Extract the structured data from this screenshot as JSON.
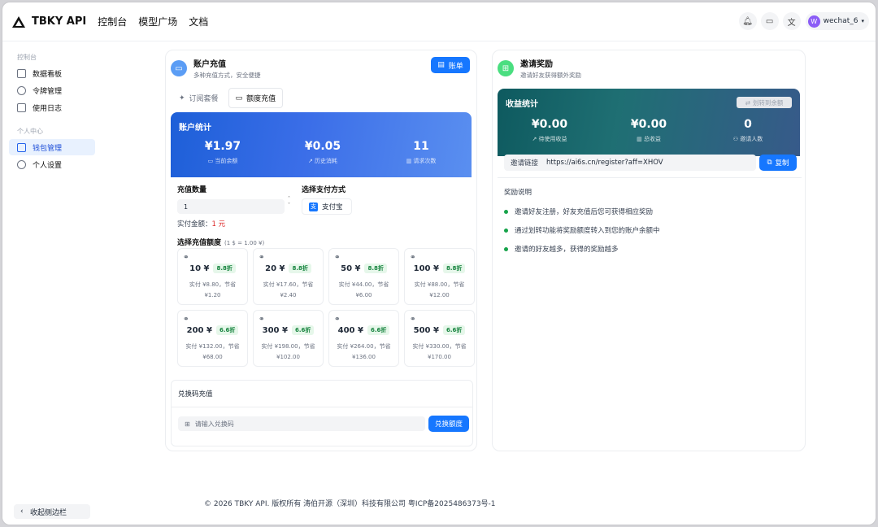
{
  "header": {
    "brand": "TBKY API",
    "nav": [
      "控制台",
      "模型广场",
      "文档"
    ],
    "user": "wechat_6",
    "avatar_letter": "W"
  },
  "sidebar": {
    "group1": "控制台",
    "items1": [
      "数据看板",
      "令牌管理",
      "使用日志"
    ],
    "group2": "个人中心",
    "items2": [
      "钱包管理",
      "个人设置"
    ],
    "collapse": "收起侧边栏"
  },
  "recharge": {
    "title": "账户充值",
    "subtitle": "多种充值方式，安全便捷",
    "bill_button": "账单",
    "tabs": [
      "订阅套餐",
      "额度充值"
    ],
    "stats_title": "账户统计",
    "stats": [
      {
        "value": "¥1.97",
        "label": "当前余额"
      },
      {
        "value": "¥0.05",
        "label": "历史消耗"
      },
      {
        "value": "11",
        "label": "请求次数"
      }
    ],
    "amount_label": "充值数量",
    "amount_value": "1",
    "pay_label": "选择支付方式",
    "pay_method": "支付宝",
    "pay_icon_char": "支",
    "actual_label": "实付金额：",
    "actual_value": "1 元",
    "select_label": "选择充值额度",
    "rate": "(1 $ = 1.00 ¥)",
    "packages": [
      {
        "amount": "10 ¥",
        "discount": "8.8折",
        "line1": "实付 ¥8.80，节省",
        "line2": "¥1.20"
      },
      {
        "amount": "20 ¥",
        "discount": "8.8折",
        "line1": "实付 ¥17.60，节省",
        "line2": "¥2.40"
      },
      {
        "amount": "50 ¥",
        "discount": "8.8折",
        "line1": "实付 ¥44.00，节省",
        "line2": "¥6.00"
      },
      {
        "amount": "100 ¥",
        "discount": "8.8折",
        "line1": "实付 ¥88.00，节省",
        "line2": "¥12.00"
      },
      {
        "amount": "200 ¥",
        "discount": "6.6折",
        "line1": "实付 ¥132.00，节省",
        "line2": "¥68.00"
      },
      {
        "amount": "300 ¥",
        "discount": "6.6折",
        "line1": "实付 ¥198.00，节省",
        "line2": "¥102.00"
      },
      {
        "amount": "400 ¥",
        "discount": "6.6折",
        "line1": "实付 ¥264.00，节省",
        "line2": "¥136.00"
      },
      {
        "amount": "500 ¥",
        "discount": "6.6折",
        "line1": "实付 ¥330.00，节省",
        "line2": "¥170.00"
      }
    ],
    "redeem_title": "兑换码充值",
    "redeem_placeholder": "请输入兑换码",
    "redeem_button": "兑换额度"
  },
  "invite": {
    "title": "邀请奖励",
    "subtitle": "邀请好友获得额外奖励",
    "stats_title": "收益统计",
    "transfer_button": "划转到余额",
    "stats": [
      {
        "value": "¥0.00",
        "label": "待使用收益"
      },
      {
        "value": "¥0.00",
        "label": "总收益"
      },
      {
        "value": "0",
        "label": "邀请人数"
      }
    ],
    "link_label": "邀请链接",
    "link": "https://ai6s.cn/register?aff=XHOV",
    "copy_button": "复制",
    "desc_title": "奖励说明",
    "bullets": [
      "邀请好友注册，好友充值后您可获得相应奖励",
      "通过划转功能将奖励额度转入到您的账户余额中",
      "邀请的好友越多，获得的奖励越多"
    ]
  },
  "footer": "© 2026 TBKY API. 版权所有   涛伯开源（深圳）科技有限公司   粤ICP备2025486373号-1"
}
